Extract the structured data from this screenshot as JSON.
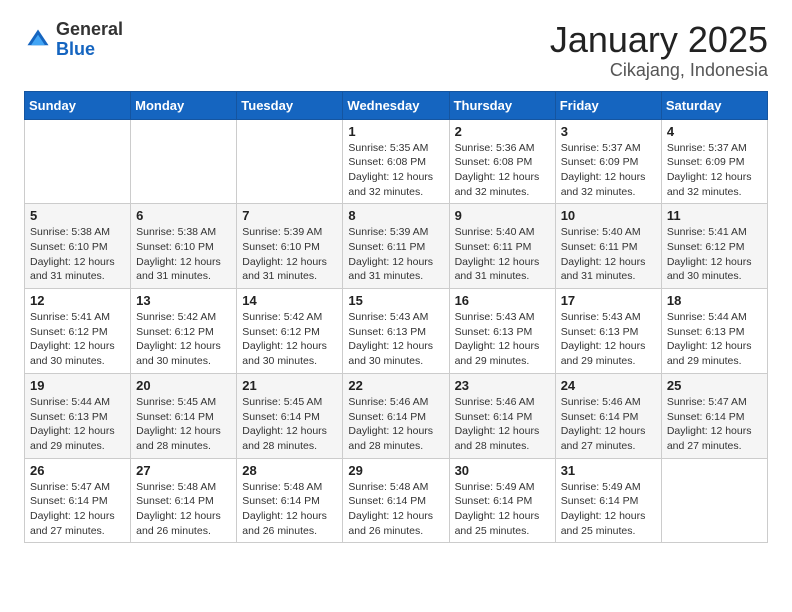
{
  "logo": {
    "general": "General",
    "blue": "Blue"
  },
  "title": "January 2025",
  "subtitle": "Cikajang, Indonesia",
  "weekdays": [
    "Sunday",
    "Monday",
    "Tuesday",
    "Wednesday",
    "Thursday",
    "Friday",
    "Saturday"
  ],
  "weeks": [
    [
      {
        "day": "",
        "info": ""
      },
      {
        "day": "",
        "info": ""
      },
      {
        "day": "",
        "info": ""
      },
      {
        "day": "1",
        "info": "Sunrise: 5:35 AM\nSunset: 6:08 PM\nDaylight: 12 hours\nand 32 minutes."
      },
      {
        "day": "2",
        "info": "Sunrise: 5:36 AM\nSunset: 6:08 PM\nDaylight: 12 hours\nand 32 minutes."
      },
      {
        "day": "3",
        "info": "Sunrise: 5:37 AM\nSunset: 6:09 PM\nDaylight: 12 hours\nand 32 minutes."
      },
      {
        "day": "4",
        "info": "Sunrise: 5:37 AM\nSunset: 6:09 PM\nDaylight: 12 hours\nand 32 minutes."
      }
    ],
    [
      {
        "day": "5",
        "info": "Sunrise: 5:38 AM\nSunset: 6:10 PM\nDaylight: 12 hours\nand 31 minutes."
      },
      {
        "day": "6",
        "info": "Sunrise: 5:38 AM\nSunset: 6:10 PM\nDaylight: 12 hours\nand 31 minutes."
      },
      {
        "day": "7",
        "info": "Sunrise: 5:39 AM\nSunset: 6:10 PM\nDaylight: 12 hours\nand 31 minutes."
      },
      {
        "day": "8",
        "info": "Sunrise: 5:39 AM\nSunset: 6:11 PM\nDaylight: 12 hours\nand 31 minutes."
      },
      {
        "day": "9",
        "info": "Sunrise: 5:40 AM\nSunset: 6:11 PM\nDaylight: 12 hours\nand 31 minutes."
      },
      {
        "day": "10",
        "info": "Sunrise: 5:40 AM\nSunset: 6:11 PM\nDaylight: 12 hours\nand 31 minutes."
      },
      {
        "day": "11",
        "info": "Sunrise: 5:41 AM\nSunset: 6:12 PM\nDaylight: 12 hours\nand 30 minutes."
      }
    ],
    [
      {
        "day": "12",
        "info": "Sunrise: 5:41 AM\nSunset: 6:12 PM\nDaylight: 12 hours\nand 30 minutes."
      },
      {
        "day": "13",
        "info": "Sunrise: 5:42 AM\nSunset: 6:12 PM\nDaylight: 12 hours\nand 30 minutes."
      },
      {
        "day": "14",
        "info": "Sunrise: 5:42 AM\nSunset: 6:12 PM\nDaylight: 12 hours\nand 30 minutes."
      },
      {
        "day": "15",
        "info": "Sunrise: 5:43 AM\nSunset: 6:13 PM\nDaylight: 12 hours\nand 30 minutes."
      },
      {
        "day": "16",
        "info": "Sunrise: 5:43 AM\nSunset: 6:13 PM\nDaylight: 12 hours\nand 29 minutes."
      },
      {
        "day": "17",
        "info": "Sunrise: 5:43 AM\nSunset: 6:13 PM\nDaylight: 12 hours\nand 29 minutes."
      },
      {
        "day": "18",
        "info": "Sunrise: 5:44 AM\nSunset: 6:13 PM\nDaylight: 12 hours\nand 29 minutes."
      }
    ],
    [
      {
        "day": "19",
        "info": "Sunrise: 5:44 AM\nSunset: 6:13 PM\nDaylight: 12 hours\nand 29 minutes."
      },
      {
        "day": "20",
        "info": "Sunrise: 5:45 AM\nSunset: 6:14 PM\nDaylight: 12 hours\nand 28 minutes."
      },
      {
        "day": "21",
        "info": "Sunrise: 5:45 AM\nSunset: 6:14 PM\nDaylight: 12 hours\nand 28 minutes."
      },
      {
        "day": "22",
        "info": "Sunrise: 5:46 AM\nSunset: 6:14 PM\nDaylight: 12 hours\nand 28 minutes."
      },
      {
        "day": "23",
        "info": "Sunrise: 5:46 AM\nSunset: 6:14 PM\nDaylight: 12 hours\nand 28 minutes."
      },
      {
        "day": "24",
        "info": "Sunrise: 5:46 AM\nSunset: 6:14 PM\nDaylight: 12 hours\nand 27 minutes."
      },
      {
        "day": "25",
        "info": "Sunrise: 5:47 AM\nSunset: 6:14 PM\nDaylight: 12 hours\nand 27 minutes."
      }
    ],
    [
      {
        "day": "26",
        "info": "Sunrise: 5:47 AM\nSunset: 6:14 PM\nDaylight: 12 hours\nand 27 minutes."
      },
      {
        "day": "27",
        "info": "Sunrise: 5:48 AM\nSunset: 6:14 PM\nDaylight: 12 hours\nand 26 minutes."
      },
      {
        "day": "28",
        "info": "Sunrise: 5:48 AM\nSunset: 6:14 PM\nDaylight: 12 hours\nand 26 minutes."
      },
      {
        "day": "29",
        "info": "Sunrise: 5:48 AM\nSunset: 6:14 PM\nDaylight: 12 hours\nand 26 minutes."
      },
      {
        "day": "30",
        "info": "Sunrise: 5:49 AM\nSunset: 6:14 PM\nDaylight: 12 hours\nand 25 minutes."
      },
      {
        "day": "31",
        "info": "Sunrise: 5:49 AM\nSunset: 6:14 PM\nDaylight: 12 hours\nand 25 minutes."
      },
      {
        "day": "",
        "info": ""
      }
    ]
  ]
}
